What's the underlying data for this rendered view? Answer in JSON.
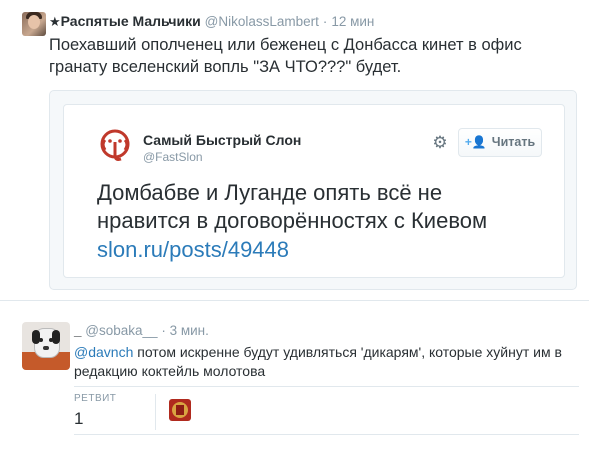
{
  "tweet1": {
    "star": "★",
    "author_name": "Распятые Мальчики",
    "handle": "@NikolassLambert",
    "separator": "·",
    "time": "12 мин",
    "text": "Поехавший ополченец или беженец с Донбасса кинет в офис гранату вселенский вопль \"ЗА ЧТО???\" будет.",
    "embed": {
      "author_name": "Самый Быстрый Слон",
      "handle": "@FastSlon",
      "follow_label": "Читать",
      "follow_icon": "+👤",
      "settings_icon": "⚙",
      "text": "Домбабве и Луганде опять всё не нравится в договорённостях с Киевом",
      "link": "slon.ru/posts/49448",
      "actions": {
        "reply": "↩",
        "retweet": "⟲",
        "favorite": "★",
        "more": "•••"
      }
    }
  },
  "tweet2": {
    "author_name": "_",
    "handle": "@sobaka__",
    "separator": "·",
    "time": "3 мин.",
    "mention": "@davnch",
    "text": " потом искренне будут удивляться 'дикарям', которые хуйнут им в редакцию коктейль молотова",
    "stats": {
      "retweets_label": "РЕТВИТ",
      "retweets_count": "1"
    }
  }
}
